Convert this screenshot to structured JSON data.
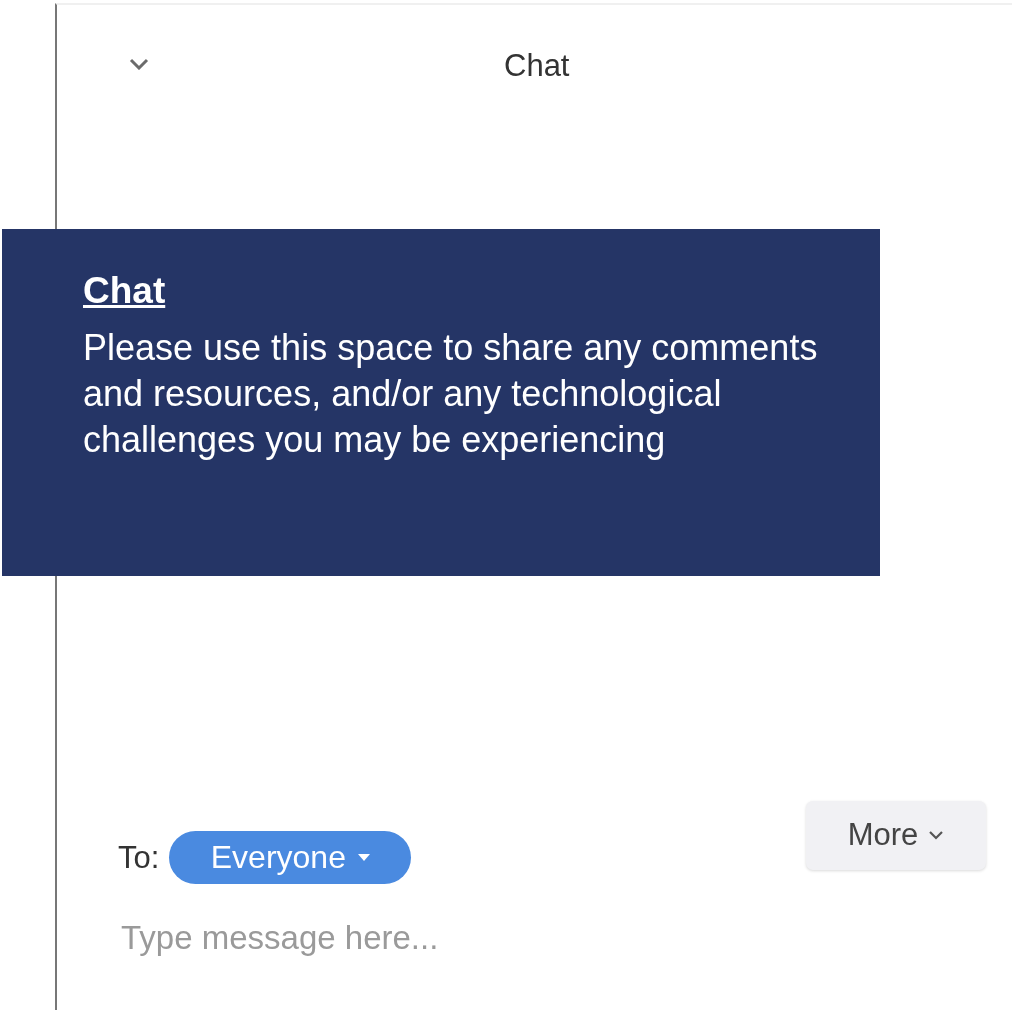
{
  "header": {
    "title": "Chat"
  },
  "callout": {
    "title": "Chat",
    "text": "Please use this space to share any comments and resources, and/or any technological challenges you may be experiencing"
  },
  "compose": {
    "to_label": "To:",
    "recipient": "Everyone",
    "more_button": "More",
    "placeholder": "Type message here..."
  }
}
